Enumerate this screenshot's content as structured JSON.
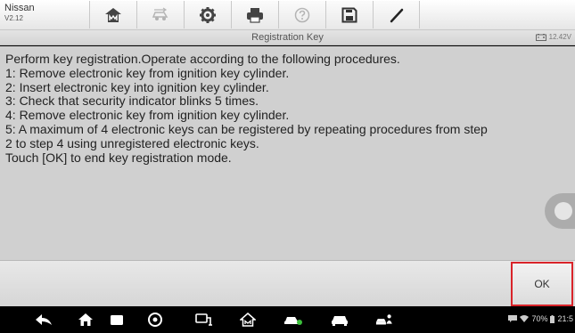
{
  "header": {
    "make": "Nissan",
    "version": "V2.12",
    "tools": [
      {
        "icon": "home-icon"
      },
      {
        "icon": "vehicle-swap-icon"
      },
      {
        "icon": "settings-gear-icon"
      },
      {
        "icon": "printer-icon"
      },
      {
        "icon": "help-icon"
      },
      {
        "icon": "save-icon"
      },
      {
        "icon": "pen-icon"
      }
    ]
  },
  "titlebar": {
    "title": "Registration Key",
    "voltage": "12.42V"
  },
  "message": {
    "lines": [
      "Perform key registration.Operate according to the following procedures.",
      "1: Remove electronic key from ignition key cylinder.",
      "2: Insert electronic key into ignition key cylinder.",
      "3: Check that security indicator blinks 5 times.",
      "4: Remove electronic key from ignition key cylinder.",
      "5: A maximum of 4 electronic keys can be registered by repeating procedures from step",
      "2 to step 4 using unregistered electronic keys.",
      "Touch [OK] to end key registration mode."
    ]
  },
  "buttons": {
    "ok_label": "OK"
  },
  "navbar": {
    "items": [
      "back-icon",
      "android-home-icon",
      "recents-icon",
      "chrome-icon",
      "vci-icon",
      "autel-home-icon",
      "car-service-icon",
      "car-icon",
      "car-people-icon"
    ],
    "battery": "70%",
    "time": "21:5"
  },
  "colors": {
    "ok_border": "#d9242a",
    "content_bg": "#d0d0d0"
  }
}
